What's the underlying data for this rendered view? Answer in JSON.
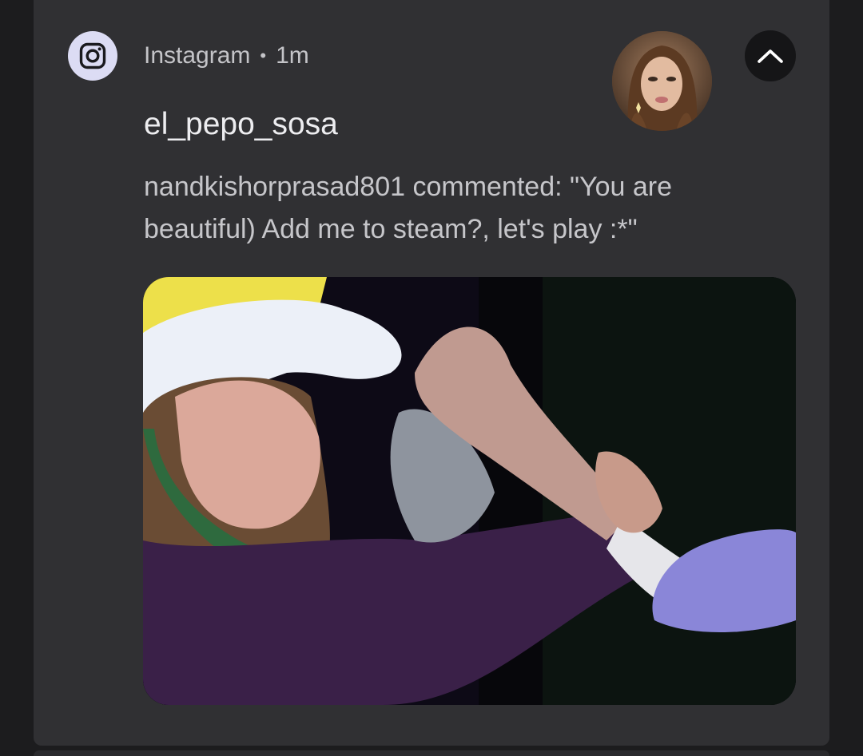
{
  "notification": {
    "app_icon": "instagram-icon",
    "app_name": "Instagram",
    "separator": "•",
    "time": "1m",
    "title": "el_pepo_sosa",
    "message": "nandkishorprasad801 commented: \"You are beautiful) Add me to steam?, let's play :*\"",
    "expand_icon": "chevron-up-icon",
    "colors": {
      "card_background": "#303033",
      "page_background": "#1c1c1e",
      "app_icon_badge": "#dcdcf4",
      "expand_button": "#151517"
    }
  }
}
